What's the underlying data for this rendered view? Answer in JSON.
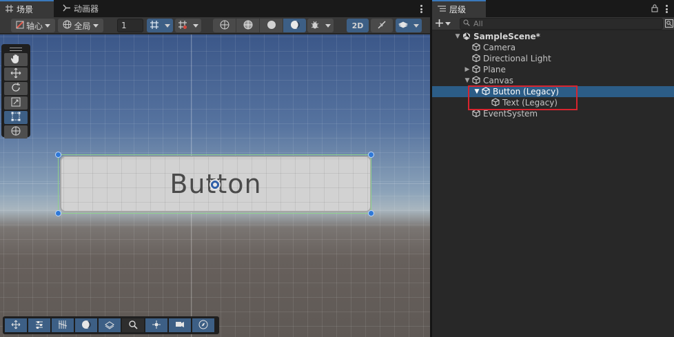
{
  "scene_tabs": {
    "scene_label": "场景",
    "animator_label": "动画器"
  },
  "scene_toolbar": {
    "pivot_label": "轴心",
    "global_label": "全局",
    "grid_snap_value": "1",
    "mode_2d_label": "2D"
  },
  "scene_view": {
    "button_text": "Button",
    "grid_color": "#ffffff",
    "rect_handle_color": "#2f78d6",
    "sky_top_color": "#3b5789",
    "ground_color": "#5f5955"
  },
  "tools_panel": {
    "items": [
      "hand-tool",
      "move-tool",
      "rotate-tool",
      "scale-tool",
      "rect-tool",
      "transform-tool"
    ],
    "active": "rect-tool"
  },
  "overlay_toolbar": {
    "items": [
      "move-overlay",
      "align-overlay",
      "grid-overlay",
      "shading-overlay",
      "layers-overlay",
      "search-overlay",
      "pivot-overlay",
      "camera-overlay",
      "compass-overlay"
    ]
  },
  "hierarchy": {
    "tab_label": "层级",
    "search_placeholder": "All",
    "rows": [
      {
        "label": "SampleScene*",
        "depth": 0,
        "expanded": true,
        "type": "scene"
      },
      {
        "label": "Camera",
        "depth": 1,
        "expanded": null,
        "type": "object"
      },
      {
        "label": "Directional Light",
        "depth": 1,
        "expanded": null,
        "type": "object"
      },
      {
        "label": "Plane",
        "depth": 1,
        "expanded": false,
        "type": "object"
      },
      {
        "label": "Canvas",
        "depth": 1,
        "expanded": true,
        "type": "object"
      },
      {
        "label": "Button (Legacy)",
        "depth": 2,
        "expanded": true,
        "type": "object",
        "selected": true
      },
      {
        "label": "Text (Legacy)",
        "depth": 3,
        "expanded": null,
        "type": "object"
      },
      {
        "label": "EventSystem",
        "depth": 1,
        "expanded": null,
        "type": "object"
      }
    ],
    "highlight_color": "#d8242e",
    "selection_color": "#2c5d87"
  }
}
